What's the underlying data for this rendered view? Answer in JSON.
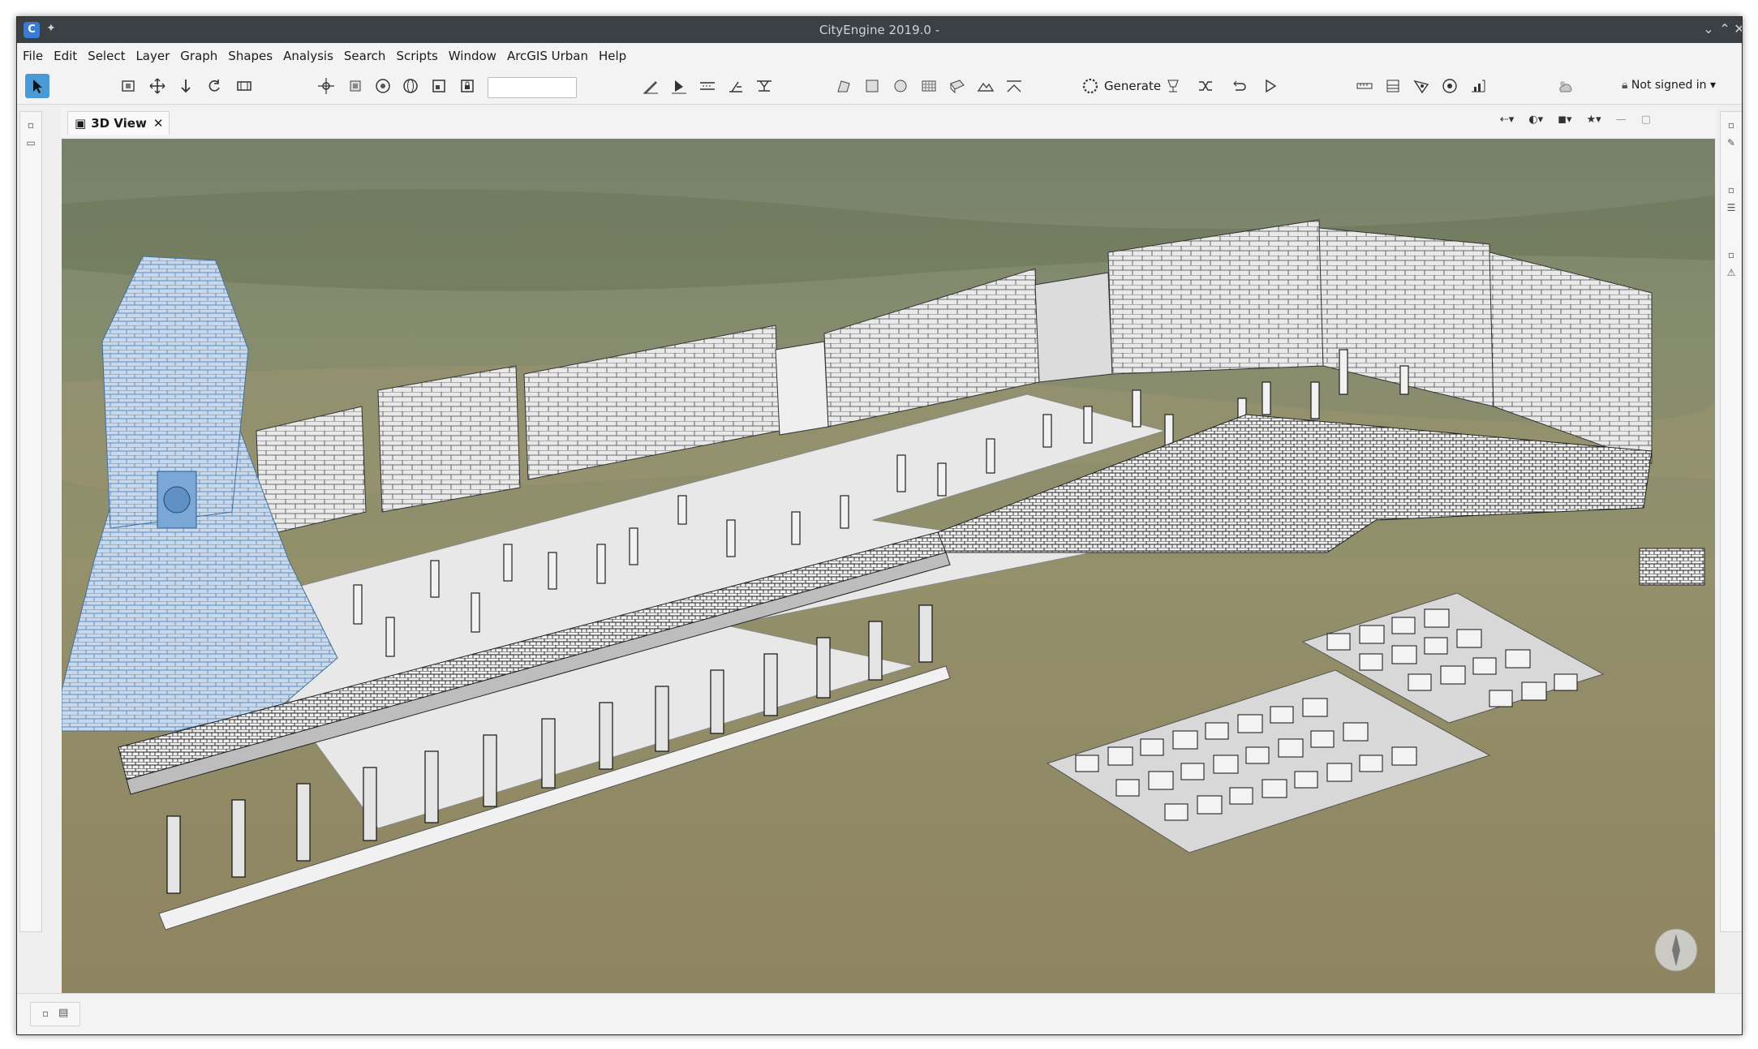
{
  "window": {
    "title": "CityEngine 2019.0 -"
  },
  "menu": [
    "File",
    "Edit",
    "Select",
    "Layer",
    "Graph",
    "Shapes",
    "Analysis",
    "Search",
    "Scripts",
    "Window",
    "ArcGIS Urban",
    "Help"
  ],
  "toolbar": {
    "generate_label": "Generate",
    "signin_label": "Not signed in",
    "viewport_search_value": ""
  },
  "view": {
    "tab_label": "3D View"
  },
  "colors": {
    "accent": "#4a9ad6",
    "titlebar": "#3b4045"
  },
  "icons": {
    "select": "cursor-arrow-icon",
    "frame": "frame-icon",
    "move": "move-icon",
    "scale": "scale-icon",
    "rotate": "rotate-icon",
    "align": "align-icon",
    "generate": "generate-icon",
    "weather": "weather-icon",
    "lock": "lock-icon"
  }
}
